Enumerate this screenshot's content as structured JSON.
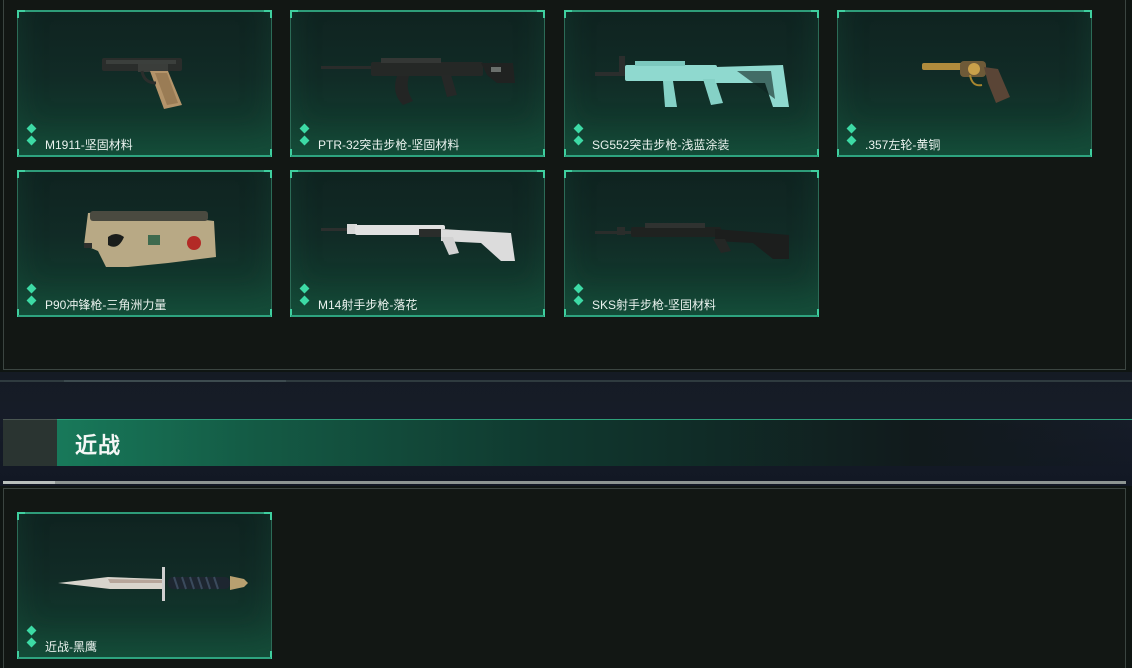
{
  "sections": [
    {
      "items": [
        {
          "label": "M1911-坚固材料",
          "icon": "pistol-icon"
        },
        {
          "label": "PTR-32突击步枪-坚固材料",
          "icon": "assault-rifle-icon"
        },
        {
          "label": "SG552突击步枪-浅蓝涂装",
          "icon": "assault-rifle-teal-icon"
        },
        {
          "label": ".357左轮-黄铜",
          "icon": "revolver-icon"
        },
        {
          "label": "P90冲锋枪-三角洲力量",
          "icon": "smg-icon"
        },
        {
          "label": "M14射手步枪-落花",
          "icon": "marksman-rifle-icon"
        },
        {
          "label": "SKS射手步枪-坚固材料",
          "icon": "sks-rifle-icon"
        }
      ]
    },
    {
      "title": "近战",
      "items": [
        {
          "label": "近战-黑鹰",
          "icon": "knife-icon"
        }
      ]
    }
  ],
  "colors": {
    "accent": "#3ddaa5",
    "card_border": "#2c6b57",
    "header_green": "#18795a",
    "background": "#0f1512"
  }
}
